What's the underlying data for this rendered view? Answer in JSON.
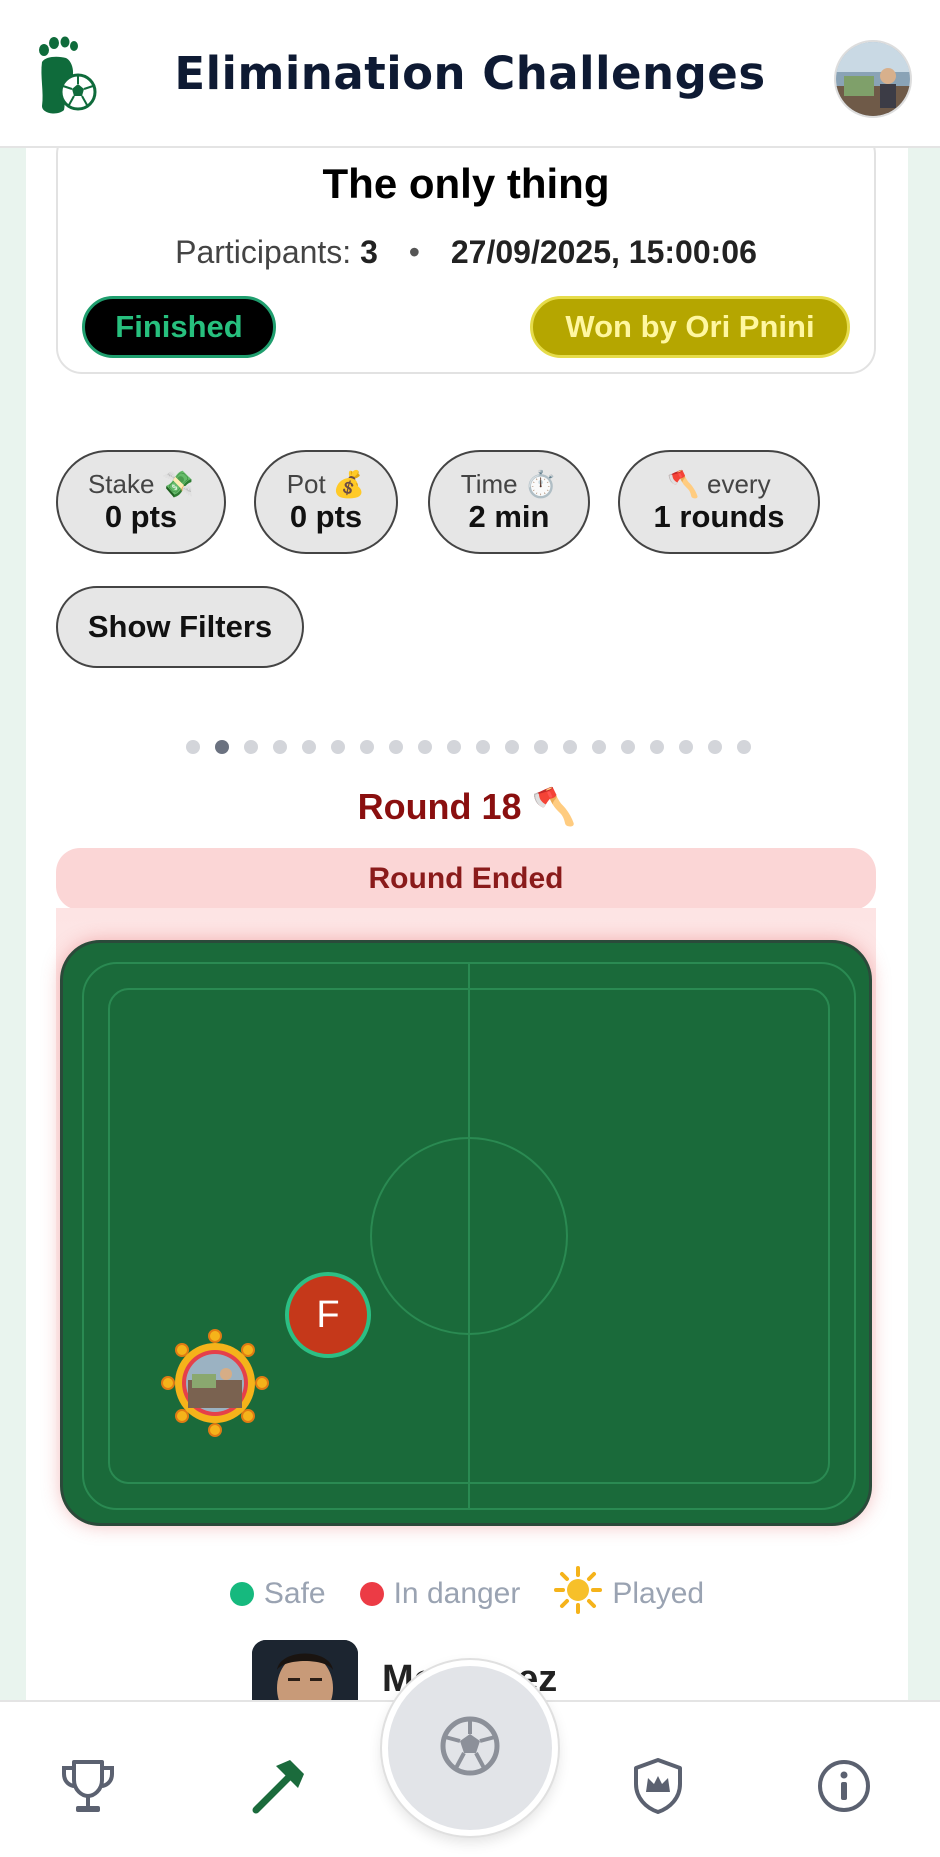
{
  "header": {
    "title": "Elimination Challenges",
    "logo_icon": "footprint-soccer-ball-icon",
    "avatar_icon": "user-avatar"
  },
  "challenge": {
    "title": "The only thing",
    "participants_label": "Participants:",
    "participants_count": "3",
    "separator": "•",
    "datetime": "27/09/2025, 15:00:06",
    "status": "Finished",
    "winner": "Won by Ori Pnini"
  },
  "stats": [
    {
      "label": "Stake 💸",
      "value": "0 pts"
    },
    {
      "label": "Pot 💰",
      "value": "0 pts"
    },
    {
      "label": "Time ⏱️",
      "value": "2 min"
    },
    {
      "label": "🪓 every",
      "value": "1 rounds"
    }
  ],
  "filters_button": "Show Filters",
  "pagination": {
    "total": 20,
    "active_index": 1
  },
  "round": {
    "title": "Round 18 🪓",
    "status": "Round Ended"
  },
  "pitch": {
    "marker_f_initial": "F"
  },
  "legend": {
    "safe": "Safe",
    "danger": "In danger",
    "played": "Played",
    "colors": {
      "safe": "#16b97e",
      "danger": "#ec3b45",
      "played": "#f5b31a"
    }
  },
  "player": {
    "name": "Mo    Hozez"
  },
  "nav": {
    "items": [
      "trophy-icon",
      "axe-icon",
      "soccer-ball-icon",
      "shield-crown-icon",
      "info-icon"
    ],
    "active": "axe-icon"
  },
  "colors": {
    "brand_green": "#1a6a3a",
    "finished_badge_text": "#27c07e",
    "winner_badge_bg": "#b5a600",
    "round_title": "#8a0f0f"
  }
}
